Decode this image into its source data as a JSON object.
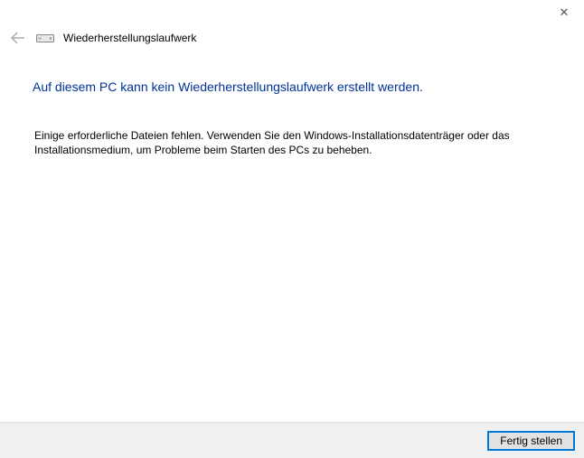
{
  "titlebar": {
    "close_glyph": "✕"
  },
  "header": {
    "window_title": "Wiederherstellungslaufwerk"
  },
  "content": {
    "heading": "Auf diesem PC kann kein Wiederherstellungslaufwerk erstellt werden.",
    "body": "Einige erforderliche Dateien fehlen. Verwenden Sie den Windows-Installationsdatenträger oder das Installationsmedium, um Probleme beim Starten des PCs zu beheben."
  },
  "footer": {
    "finish_label": "Fertig stellen"
  }
}
